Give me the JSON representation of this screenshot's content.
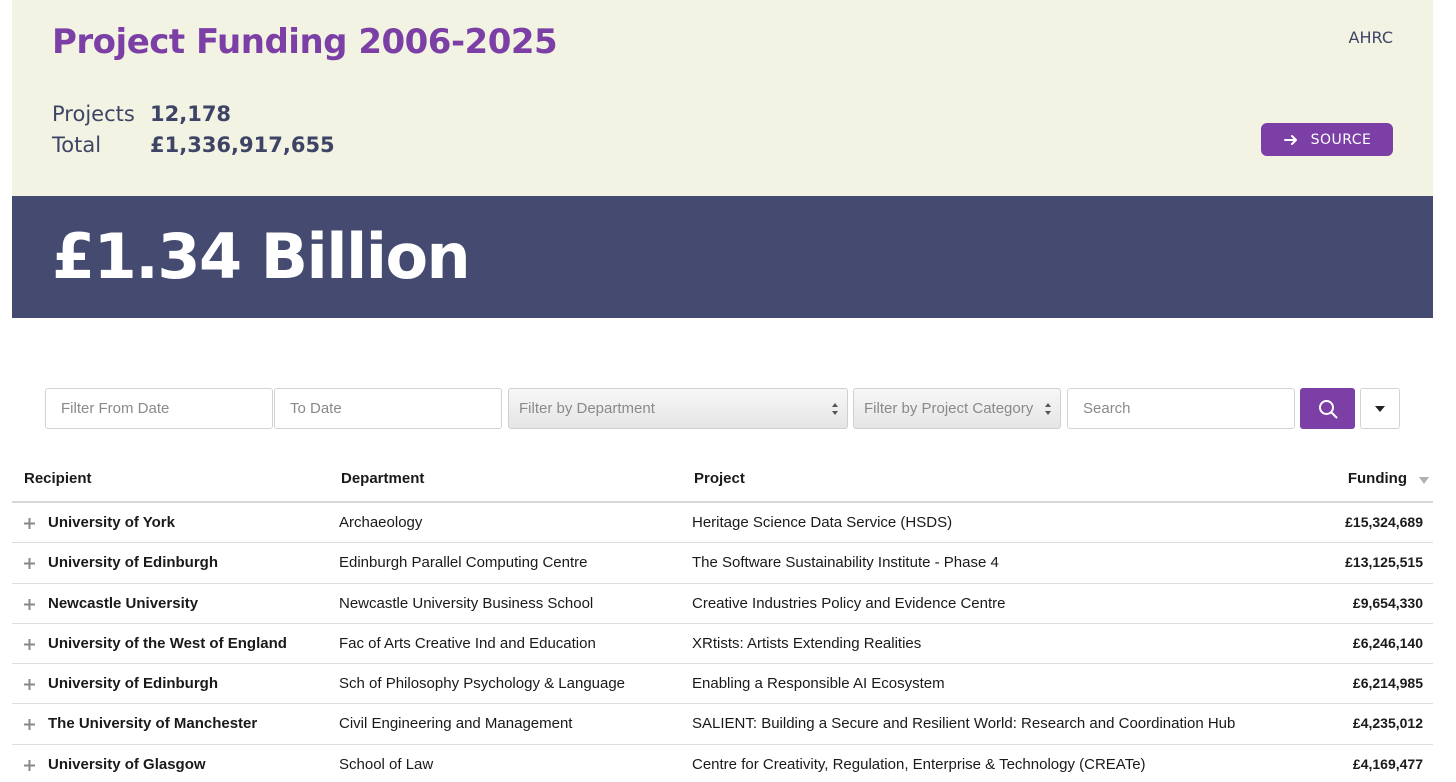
{
  "header": {
    "title": "Project Funding 2006-2025",
    "org": "AHRC",
    "stats": [
      {
        "label": "Projects",
        "value": "12,178"
      },
      {
        "label": "Total",
        "value": "£1,336,917,655"
      }
    ],
    "source_button": {
      "label": "SOURCE",
      "icon": "arrow-right-icon"
    },
    "accent_color": "#7b3fa6",
    "background_color": "#f3f3e3"
  },
  "hero": {
    "amount": "£1.34 Billion",
    "background_color": "#444a70"
  },
  "filters": {
    "from_date_placeholder": "Filter From Date",
    "to_date_placeholder": "To Date",
    "department_select": "Filter by Department",
    "category_select": "Filter by Project Category",
    "search_placeholder": "Search",
    "search_button_icon": "search-icon",
    "menu_button_icon": "caret-down-icon"
  },
  "table": {
    "columns": [
      "Recipient",
      "Department",
      "Project",
      "Funding"
    ],
    "sort": {
      "column": "Funding",
      "direction": "descending"
    },
    "rows": [
      {
        "recipient": "University of York",
        "department": "Archaeology",
        "project": "Heritage Science Data Service (HSDS)",
        "funding": "£15,324,689"
      },
      {
        "recipient": "University of Edinburgh",
        "department": "Edinburgh Parallel Computing Centre",
        "project": "The Software Sustainability Institute - Phase 4",
        "funding": "£13,125,515"
      },
      {
        "recipient": "Newcastle University",
        "department": "Newcastle University Business School",
        "project": "Creative Industries Policy and Evidence Centre",
        "funding": "£9,654,330"
      },
      {
        "recipient": "University of the West of England",
        "department": "Fac of Arts Creative Ind and Education",
        "project": "XRtists: Artists Extending Realities",
        "funding": "£6,246,140"
      },
      {
        "recipient": "University of Edinburgh",
        "department": "Sch of Philosophy Psychology & Language",
        "project": "Enabling a Responsible AI Ecosystem",
        "funding": "£6,214,985"
      },
      {
        "recipient": "The University of Manchester",
        "department": "Civil Engineering and Management",
        "project": "SALIENT: Building a Secure and Resilient World: Research and Coordination Hub",
        "funding": "£4,235,012"
      },
      {
        "recipient": "University of Glasgow",
        "department": "School of Law",
        "project": "Centre for Creativity, Regulation, Enterprise & Technology (CREATe)",
        "funding": "£4,169,477"
      }
    ]
  }
}
